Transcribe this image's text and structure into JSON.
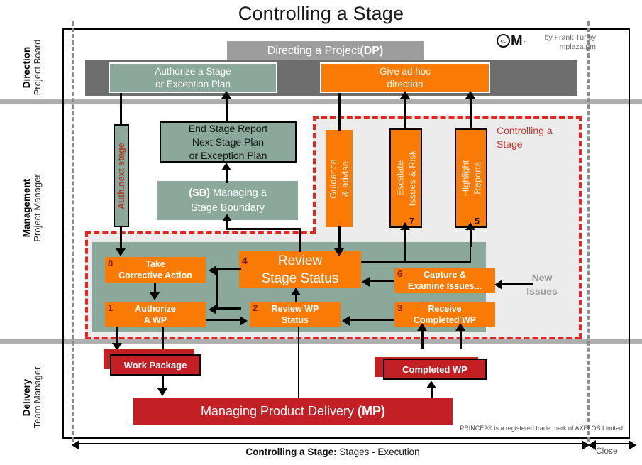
{
  "title": "Controlling a Stage",
  "credit": {
    "line1": "by Frank Turley",
    "line2": "mplaza.pm",
    "cc": "cc",
    "m": "M",
    "chev": "›"
  },
  "lanes": [
    {
      "role": "Direction",
      "person": "Project Board"
    },
    {
      "role": "Management",
      "person": "Project Manager"
    },
    {
      "role": "Delivery",
      "person": "Team Manager"
    }
  ],
  "direction": {
    "dp_title": "Directing a Project ",
    "dp_title_bold": "(DP)",
    "authorize_stage": "Authorize a Stage",
    "authorize_stage2": "or Exception Plan",
    "ad_hoc": "Give ad hoc",
    "ad_hoc2": "direction"
  },
  "management": {
    "auth_next_stage": "Auth.next stage",
    "end_stage_report": "End Stage Report",
    "next_stage_plan": "Next Stage Plan",
    "or_exception_plan": "or Exception Plan",
    "sb_bold": "(SB)",
    "sb_rest": " Managing  a",
    "sb_line2": "Stage  Boundary",
    "guidance1": "Guidance",
    "guidance2": "& advise",
    "escalate1": "Escalate",
    "escalate2": "Issues & Risk",
    "escalate_num": "7",
    "highlight1": "Highlight",
    "highlight2": "Reports",
    "highlight_num": "5",
    "cs_label1": "Controlling a",
    "cs_label2": "Stage",
    "new_issues1": "New",
    "new_issues2": "Issues",
    "activities": [
      {
        "num": "8",
        "line1": "Take",
        "line2": "Corrective Action"
      },
      {
        "num": "4",
        "line1": "Review",
        "line2": "Stage Status"
      },
      {
        "num": "6",
        "line1": "Capture &",
        "line2": "Examine Issues..."
      },
      {
        "num": "1",
        "line1": "Authorize",
        "line2": "A WP"
      },
      {
        "num": "2",
        "line1": "Review WP",
        "line2": "Status"
      },
      {
        "num": "3",
        "line1": "Receive",
        "line2": "Completed WP"
      }
    ]
  },
  "delivery": {
    "work_package": "Work Package",
    "completed_wp": "Completed WP",
    "mp_text": "Managing Product Delivery ",
    "mp_bold": "(MP)",
    "trademark": "PRINCE2® is a registered trade mark of AXELOS Limited"
  },
  "axis": {
    "caption_bold": "Controlling a Stage:",
    "caption_rest": " Stages - Execution",
    "close": "Close"
  },
  "colors": {
    "orange": "#f97b06",
    "green": "#8ba99b",
    "red": "#c32026",
    "grey_band": "#6e6e6e",
    "grey_title": "#9d9d9d",
    "dashed_red": "#e8241f",
    "panel_grey": "#ececed"
  }
}
